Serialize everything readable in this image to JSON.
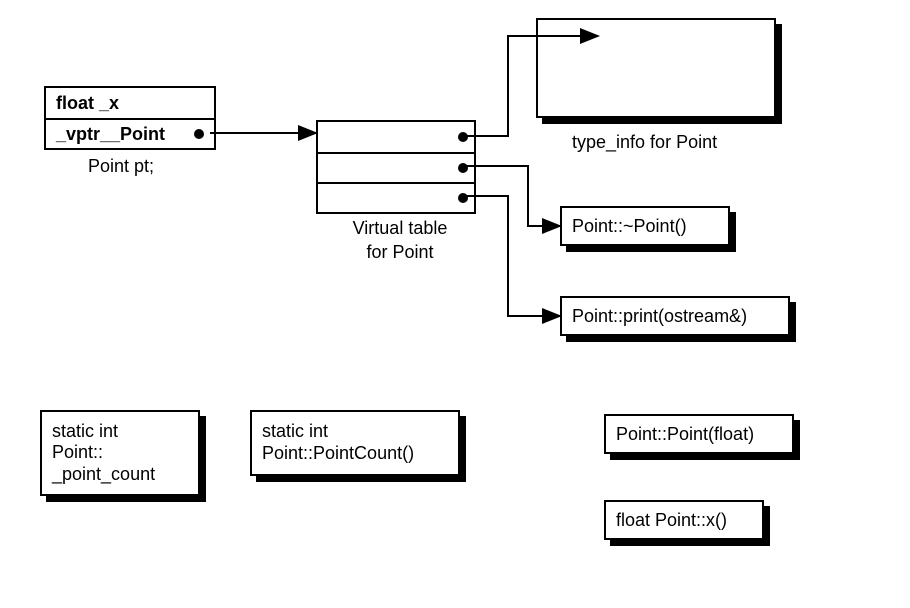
{
  "point_object": {
    "rows": [
      "float _x",
      "_vptr__Point"
    ],
    "caption": "Point pt;"
  },
  "vtable": {
    "caption_line1": "Virtual table",
    "caption_line2": "for Point"
  },
  "type_info": {
    "caption": "type_info for Point"
  },
  "targets": {
    "dtor": "Point::~Point()",
    "print": "Point::print(ostream&)"
  },
  "free_boxes": {
    "static_var_line1": "static int",
    "static_var_line2": "Point::",
    "static_var_line3": "_point_count",
    "static_fn_line1": "static int",
    "static_fn_line2": "Point::PointCount()",
    "ctor": "Point::Point(float)",
    "x_fn": "float Point::x()"
  }
}
